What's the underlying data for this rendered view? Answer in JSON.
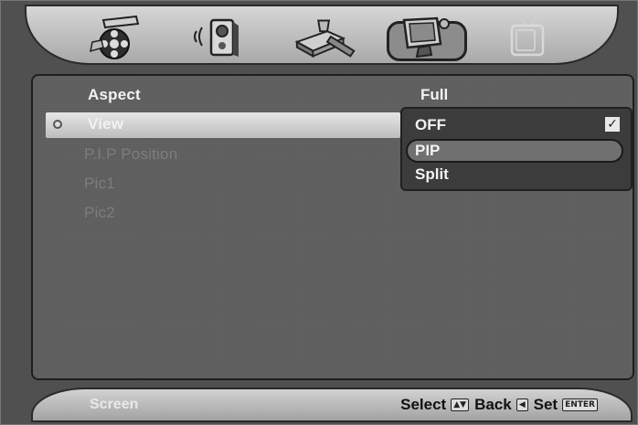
{
  "tabs": [
    {
      "icon": "film-reel-icon",
      "selected": false
    },
    {
      "icon": "speaker-icon",
      "selected": false
    },
    {
      "icon": "tools-icon",
      "selected": false
    },
    {
      "icon": "monitor-icon",
      "selected": true
    },
    {
      "icon": "tv-icon",
      "selected": false,
      "disabled": true
    }
  ],
  "menu": {
    "aspect_label": "Aspect",
    "aspect_value": "Full",
    "view_label": "View",
    "pip_position_label": "P.I.P Position",
    "pic1_label": "Pic1",
    "pic2_label": "Pic2"
  },
  "dropdown": {
    "options": [
      "OFF",
      "PIP",
      "Split"
    ],
    "checked": "OFF",
    "highlighted": "PIP"
  },
  "footer": {
    "screen_label": "Screen",
    "select_label": "Select",
    "select_key": "▲▼",
    "back_label": "Back",
    "back_key": "◀",
    "set_label": "Set",
    "set_key": "ENTER"
  },
  "colors": {
    "highlight": "#d4d4d4",
    "panel": "#5e5e5e",
    "dropdown": "#3c3c3c"
  }
}
